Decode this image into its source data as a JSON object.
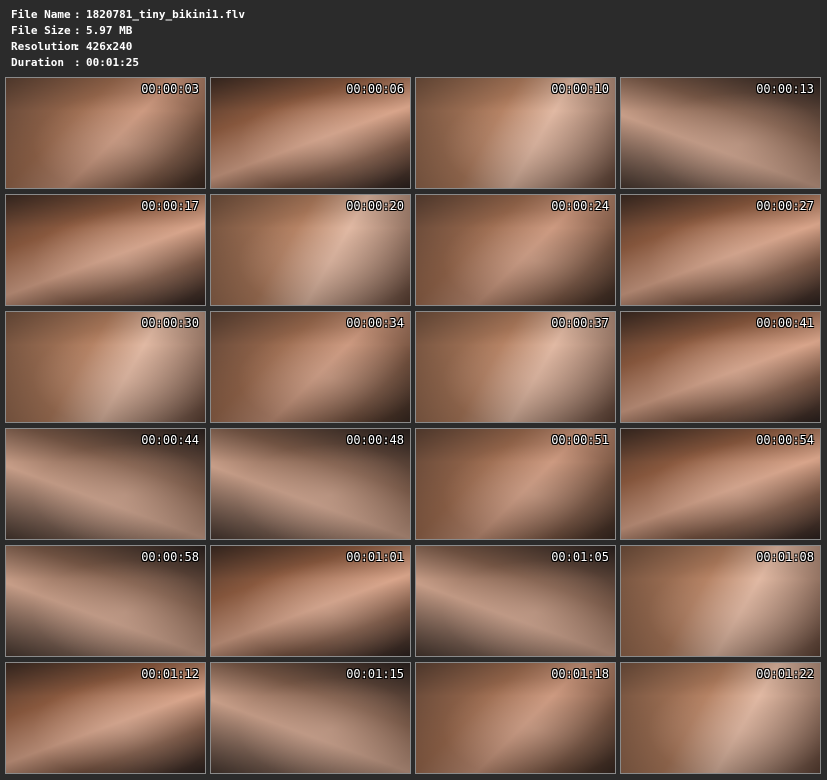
{
  "file_info": {
    "name_label": "File Name",
    "name_value": "1820781_tiny_bikini1.flv",
    "size_label": "File Size",
    "size_value": "5.97 MB",
    "resolution_label": "Resolution",
    "resolution_value": "426x240",
    "duration_label": "Duration",
    "duration_value": "00:01:25",
    "separator": ":"
  },
  "thumbnails": [
    "00:00:03",
    "00:00:06",
    "00:00:10",
    "00:00:13",
    "00:00:17",
    "00:00:20",
    "00:00:24",
    "00:00:27",
    "00:00:30",
    "00:00:34",
    "00:00:37",
    "00:00:41",
    "00:00:44",
    "00:00:48",
    "00:00:51",
    "00:00:54",
    "00:00:58",
    "00:01:01",
    "00:01:05",
    "00:01:08",
    "00:01:12",
    "00:01:15",
    "00:01:18",
    "00:01:22"
  ],
  "colors": {
    "background": "#2b2b2b",
    "text": "#ffffff",
    "thumb_border": "#8a8a8a"
  }
}
